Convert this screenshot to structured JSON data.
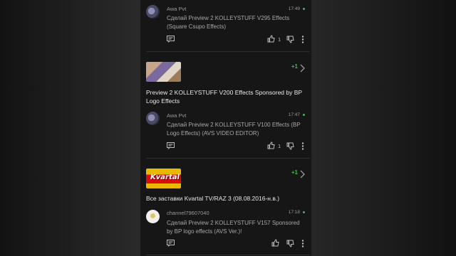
{
  "comments": [
    {
      "author": "Awa Pvt",
      "time": "17:49",
      "text": "Сделай Preview 2 KOLLEYSTUFF V295 Effects (Square Csupo Effects)",
      "likes": "1"
    },
    {
      "author": "Awa Pvt",
      "time": "17:47",
      "text": "Сделай Preview 2 KOLLEYSTUFF V100 Effects (BP Logo Effects) (AVS VIDEO EDITOR)",
      "likes": "1"
    },
    {
      "author": "channel79607040",
      "time": "17:18",
      "text": "Сделай Preview 2 KOLLEYSTUFF V157 Sponsored by BP logo effects (AVS Ver.)!",
      "likes": ""
    }
  ],
  "videos": [
    {
      "badge": "+1",
      "title": "Preview 2 KOLLEYSTUFF V200 Effects Sponsored by BP Logo Effects"
    },
    {
      "badge": "+1",
      "title": "Все заставки Kvartal TV/RAZ 3 (08.08.2016-н.в.)",
      "thumb_text": "Kvartal"
    }
  ],
  "colors": {
    "accent": "#3fb950",
    "background": "#161616"
  },
  "icons": [
    "reply-icon",
    "thumbs-up-icon",
    "thumbs-down-icon",
    "more-icon",
    "chevron-right-icon"
  ]
}
